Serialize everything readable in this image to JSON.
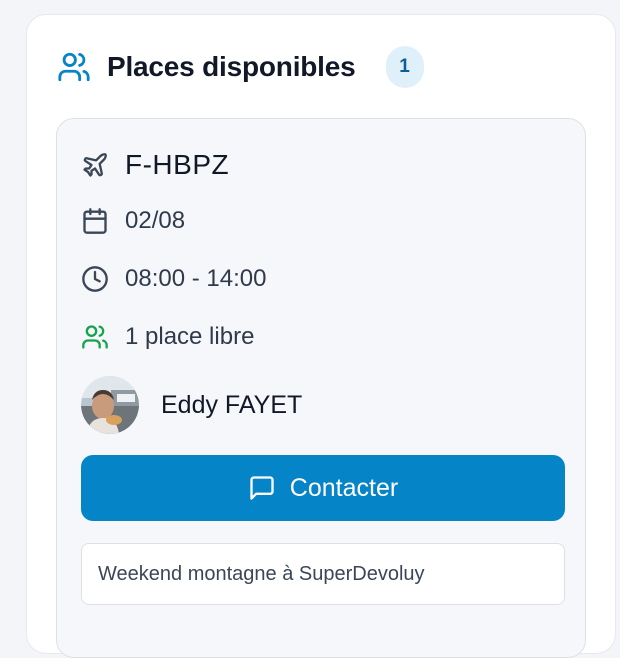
{
  "panel": {
    "title": "Places disponibles",
    "count": "1",
    "icon": "users-icon",
    "accent_color": "#0684c8"
  },
  "listing": {
    "aircraft": {
      "icon": "plane-icon",
      "registration": "F-HBPZ"
    },
    "date": {
      "icon": "calendar-icon",
      "value": "02/08"
    },
    "time": {
      "icon": "clock-icon",
      "value": "08:00 - 14:00"
    },
    "seats": {
      "icon": "users-icon",
      "value": "1 place libre",
      "color": "#16a34a"
    },
    "pilot": {
      "name": "Eddy FAYET"
    },
    "contact_button": {
      "icon": "message-square-icon",
      "label": "Contacter"
    },
    "note": "Weekend montagne à SuperDevoluy"
  }
}
